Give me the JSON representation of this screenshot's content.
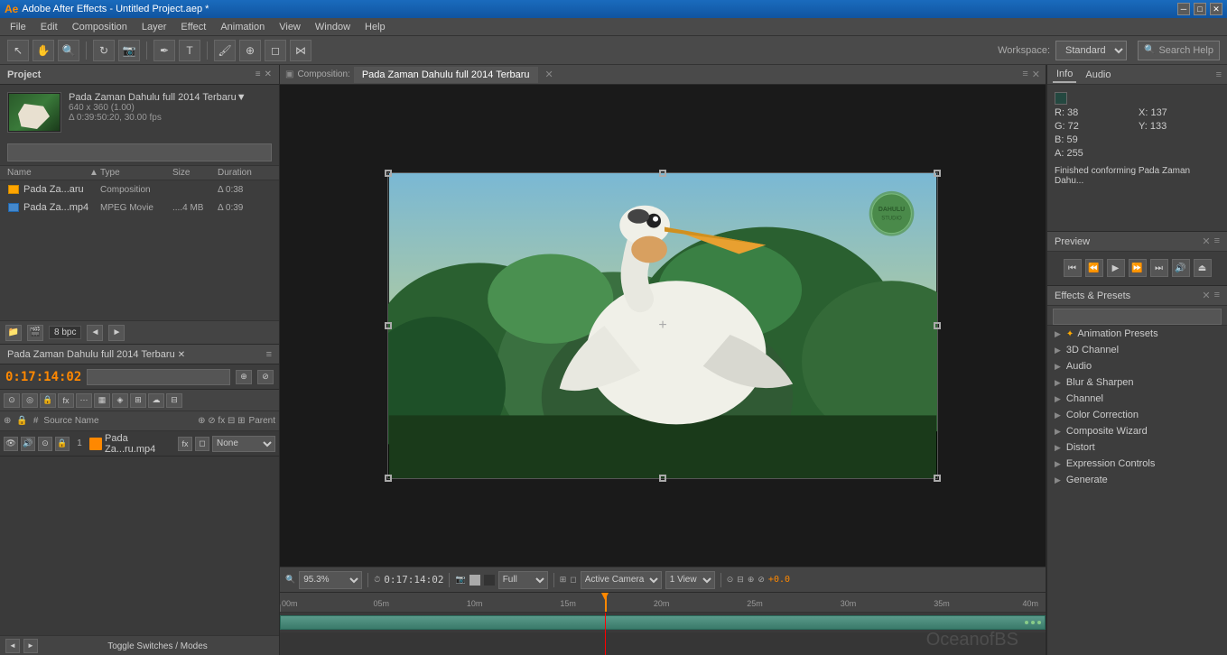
{
  "titleBar": {
    "title": "Adobe After Effects - Untitled Project.aep *",
    "appIcon": "AE"
  },
  "menuBar": {
    "items": [
      "File",
      "Edit",
      "Composition",
      "Layer",
      "Effect",
      "Animation",
      "View",
      "Window",
      "Help"
    ]
  },
  "toolbar": {
    "workspace_label": "Workspace:",
    "workspace_value": "Standard",
    "search_help_placeholder": "Search Help"
  },
  "projectPanel": {
    "title": "Project",
    "compositionName": "Pada Zaman Dahulu full 2014 Terbaru▼",
    "resolution": "640 x 360 (1.00)",
    "duration": "Δ 0:39:50:20, 30.00 fps",
    "columns": [
      "Name",
      "▲",
      "Type",
      "Size",
      "Duration"
    ],
    "items": [
      {
        "name": "Pada Za...aru",
        "type": "Composition",
        "size": "",
        "duration": "Δ 0:38",
        "iconType": "comp"
      },
      {
        "name": "Pada Za...mp4",
        "type": "MPEG Movie",
        "size": "....4 MB",
        "duration": "Δ 0:39",
        "iconType": "movie"
      }
    ],
    "bpc": "8 bpc"
  },
  "compositionPanel": {
    "title": "Composition: Pada Zaman Dahulu full 2014 Terbaru",
    "tabLabel": "Pada Zaman Dahulu full 2014 Terbaru",
    "zoomLevel": "95.3%",
    "timecode": "0:17:14:02",
    "quality": "Full",
    "viewMode": "Active Camera",
    "viewLayout": "1 View",
    "plusOffset": "+0.0",
    "watermark": "Dahulu"
  },
  "infoPanel": {
    "title": "Info",
    "tabs": [
      "Info",
      "Audio"
    ],
    "colorLabel": "Color",
    "rValue": "R: 38",
    "gValue": "G: 72",
    "bValue": "B: 59",
    "aValue": "A: 255",
    "xValue": "X: 137",
    "yValue": "Y: 133",
    "message": "Finished conforming Pada Zaman Dahu..."
  },
  "previewPanel": {
    "title": "Preview",
    "buttons": [
      "⏮",
      "⏪",
      "▶",
      "⏩",
      "⏭",
      "🔊",
      "⏏"
    ]
  },
  "effectsPanel": {
    "title": "Effects & Presets",
    "searchPlaceholder": "",
    "items": [
      {
        "label": "* Animation Presets",
        "starred": true
      },
      {
        "label": "3D Channel",
        "starred": false
      },
      {
        "label": "Audio",
        "starred": false
      },
      {
        "label": "Blur & Sharpen",
        "starred": false
      },
      {
        "label": "Channel",
        "starred": false
      },
      {
        "label": "Color Correction",
        "starred": false
      },
      {
        "label": "Composite Wizard",
        "starred": false
      },
      {
        "label": "Distort",
        "starred": false
      },
      {
        "label": "Expression Controls",
        "starred": false
      },
      {
        "label": "Generate",
        "starred": false
      }
    ]
  },
  "timelinePanel": {
    "compName": "Pada Zaman Dahulu full 2014 Terbaru",
    "timecode": "0:17:14:02",
    "layerNum": "1",
    "layerName": "Pada Za...ru.mp4",
    "parentValue": "None",
    "rulerMarks": [
      {
        "label": "00m",
        "pos": 0
      },
      {
        "label": "05m",
        "pos": 12.2
      },
      {
        "label": "10m",
        "pos": 24.4
      },
      {
        "label": "15m",
        "pos": 36.6
      },
      {
        "label": "20m",
        "pos": 48.8
      },
      {
        "label": "25m",
        "pos": 61
      },
      {
        "label": "30m",
        "pos": 73.2
      },
      {
        "label": "35m",
        "pos": 85.4
      },
      {
        "label": "40m",
        "pos": 97.6
      }
    ],
    "playheadPos": 42.5,
    "toggleSwitchesLabel": "Toggle Switches / Modes",
    "footerButtons": [
      "◄",
      "►"
    ]
  }
}
